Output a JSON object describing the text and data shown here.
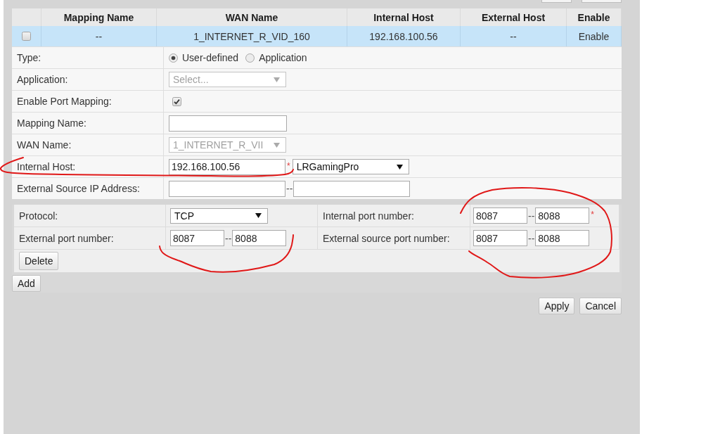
{
  "table": {
    "columns": [
      "Mapping Name",
      "WAN Name",
      "Internal Host",
      "External Host",
      "Enable"
    ],
    "rows": [
      {
        "selected": true,
        "checked": false,
        "cells": [
          "--",
          "1_INTERNET_R_VID_160",
          "192.168.100.56",
          "--",
          "Enable"
        ]
      }
    ]
  },
  "form": {
    "fields": [
      {
        "kind": "radio",
        "label": "Type:",
        "options": [
          {
            "label": "User-defined",
            "selected": true
          },
          {
            "label": "Application",
            "selected": false
          }
        ]
      },
      {
        "kind": "select",
        "label": "Application:",
        "placeholder": "Select...",
        "disabled": true
      },
      {
        "kind": "checkbox",
        "label": "Enable Port Mapping:",
        "checked": true
      },
      {
        "kind": "text",
        "label": "Mapping Name:"
      },
      {
        "kind": "select",
        "label": "WAN Name:",
        "value": "1_INTERNET_R_VII",
        "disabled": true
      },
      {
        "kind": "host",
        "label": "Internal Host:",
        "value": "192.168.100.56",
        "required_mark": "*",
        "device": {
          "value": "LRGamingPro",
          "disabled": false
        }
      },
      {
        "kind": "range",
        "label": "External Source IP Address:",
        "separator": "--"
      }
    ]
  },
  "port_table": {
    "rows": [
      [
        {
          "kind": "select",
          "label": "Protocol:",
          "value": "TCP",
          "disabled": false
        },
        {
          "kind": "range",
          "label": "Internal port number:",
          "from": "8087",
          "to": "8088",
          "separator": "--",
          "required_mark": "*"
        }
      ],
      [
        {
          "kind": "range",
          "label": "External port number:",
          "from": "8087",
          "to": "8088",
          "separator": "--"
        },
        {
          "kind": "range",
          "label": "External source port number:",
          "from": "8087",
          "to": "8088",
          "separator": "--"
        }
      ]
    ],
    "delete_button": "Delete"
  },
  "add_button": "Add",
  "buttons": [
    "Apply",
    "Cancel"
  ]
}
